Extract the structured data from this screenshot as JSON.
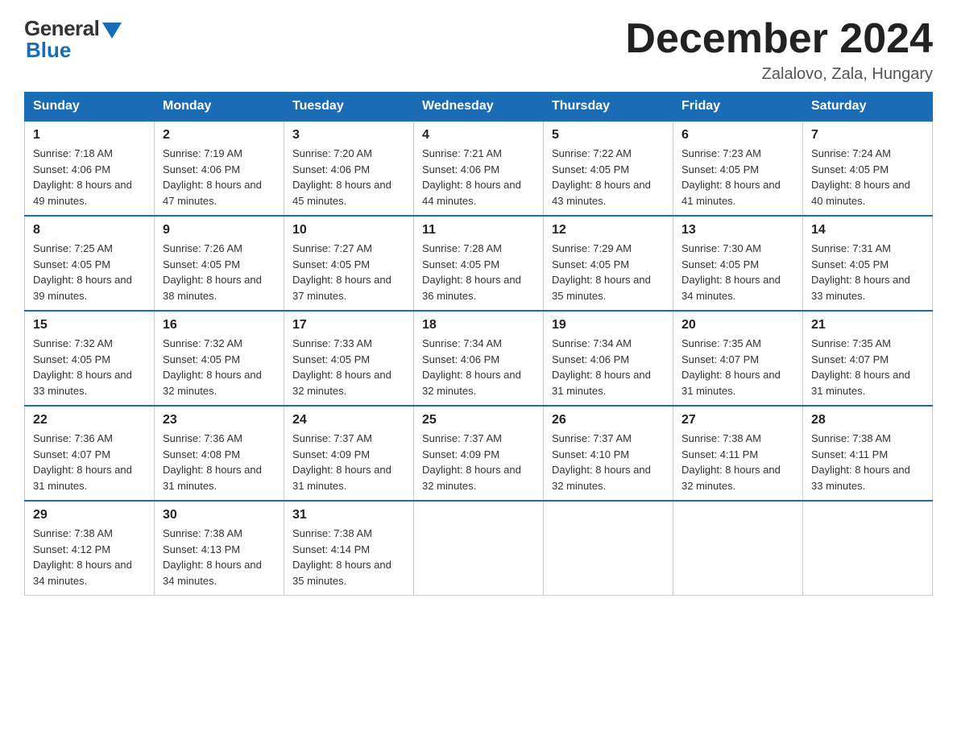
{
  "logo": {
    "general": "General",
    "blue": "Blue"
  },
  "title": "December 2024",
  "location": "Zalalovo, Zala, Hungary",
  "days_header": [
    "Sunday",
    "Monday",
    "Tuesday",
    "Wednesday",
    "Thursday",
    "Friday",
    "Saturday"
  ],
  "weeks": [
    [
      {
        "day": "1",
        "sunrise": "7:18 AM",
        "sunset": "4:06 PM",
        "daylight": "8 hours and 49 minutes."
      },
      {
        "day": "2",
        "sunrise": "7:19 AM",
        "sunset": "4:06 PM",
        "daylight": "8 hours and 47 minutes."
      },
      {
        "day": "3",
        "sunrise": "7:20 AM",
        "sunset": "4:06 PM",
        "daylight": "8 hours and 45 minutes."
      },
      {
        "day": "4",
        "sunrise": "7:21 AM",
        "sunset": "4:06 PM",
        "daylight": "8 hours and 44 minutes."
      },
      {
        "day": "5",
        "sunrise": "7:22 AM",
        "sunset": "4:05 PM",
        "daylight": "8 hours and 43 minutes."
      },
      {
        "day": "6",
        "sunrise": "7:23 AM",
        "sunset": "4:05 PM",
        "daylight": "8 hours and 41 minutes."
      },
      {
        "day": "7",
        "sunrise": "7:24 AM",
        "sunset": "4:05 PM",
        "daylight": "8 hours and 40 minutes."
      }
    ],
    [
      {
        "day": "8",
        "sunrise": "7:25 AM",
        "sunset": "4:05 PM",
        "daylight": "8 hours and 39 minutes."
      },
      {
        "day": "9",
        "sunrise": "7:26 AM",
        "sunset": "4:05 PM",
        "daylight": "8 hours and 38 minutes."
      },
      {
        "day": "10",
        "sunrise": "7:27 AM",
        "sunset": "4:05 PM",
        "daylight": "8 hours and 37 minutes."
      },
      {
        "day": "11",
        "sunrise": "7:28 AM",
        "sunset": "4:05 PM",
        "daylight": "8 hours and 36 minutes."
      },
      {
        "day": "12",
        "sunrise": "7:29 AM",
        "sunset": "4:05 PM",
        "daylight": "8 hours and 35 minutes."
      },
      {
        "day": "13",
        "sunrise": "7:30 AM",
        "sunset": "4:05 PM",
        "daylight": "8 hours and 34 minutes."
      },
      {
        "day": "14",
        "sunrise": "7:31 AM",
        "sunset": "4:05 PM",
        "daylight": "8 hours and 33 minutes."
      }
    ],
    [
      {
        "day": "15",
        "sunrise": "7:32 AM",
        "sunset": "4:05 PM",
        "daylight": "8 hours and 33 minutes."
      },
      {
        "day": "16",
        "sunrise": "7:32 AM",
        "sunset": "4:05 PM",
        "daylight": "8 hours and 32 minutes."
      },
      {
        "day": "17",
        "sunrise": "7:33 AM",
        "sunset": "4:05 PM",
        "daylight": "8 hours and 32 minutes."
      },
      {
        "day": "18",
        "sunrise": "7:34 AM",
        "sunset": "4:06 PM",
        "daylight": "8 hours and 32 minutes."
      },
      {
        "day": "19",
        "sunrise": "7:34 AM",
        "sunset": "4:06 PM",
        "daylight": "8 hours and 31 minutes."
      },
      {
        "day": "20",
        "sunrise": "7:35 AM",
        "sunset": "4:07 PM",
        "daylight": "8 hours and 31 minutes."
      },
      {
        "day": "21",
        "sunrise": "7:35 AM",
        "sunset": "4:07 PM",
        "daylight": "8 hours and 31 minutes."
      }
    ],
    [
      {
        "day": "22",
        "sunrise": "7:36 AM",
        "sunset": "4:07 PM",
        "daylight": "8 hours and 31 minutes."
      },
      {
        "day": "23",
        "sunrise": "7:36 AM",
        "sunset": "4:08 PM",
        "daylight": "8 hours and 31 minutes."
      },
      {
        "day": "24",
        "sunrise": "7:37 AM",
        "sunset": "4:09 PM",
        "daylight": "8 hours and 31 minutes."
      },
      {
        "day": "25",
        "sunrise": "7:37 AM",
        "sunset": "4:09 PM",
        "daylight": "8 hours and 32 minutes."
      },
      {
        "day": "26",
        "sunrise": "7:37 AM",
        "sunset": "4:10 PM",
        "daylight": "8 hours and 32 minutes."
      },
      {
        "day": "27",
        "sunrise": "7:38 AM",
        "sunset": "4:11 PM",
        "daylight": "8 hours and 32 minutes."
      },
      {
        "day": "28",
        "sunrise": "7:38 AM",
        "sunset": "4:11 PM",
        "daylight": "8 hours and 33 minutes."
      }
    ],
    [
      {
        "day": "29",
        "sunrise": "7:38 AM",
        "sunset": "4:12 PM",
        "daylight": "8 hours and 34 minutes."
      },
      {
        "day": "30",
        "sunrise": "7:38 AM",
        "sunset": "4:13 PM",
        "daylight": "8 hours and 34 minutes."
      },
      {
        "day": "31",
        "sunrise": "7:38 AM",
        "sunset": "4:14 PM",
        "daylight": "8 hours and 35 minutes."
      },
      null,
      null,
      null,
      null
    ]
  ]
}
